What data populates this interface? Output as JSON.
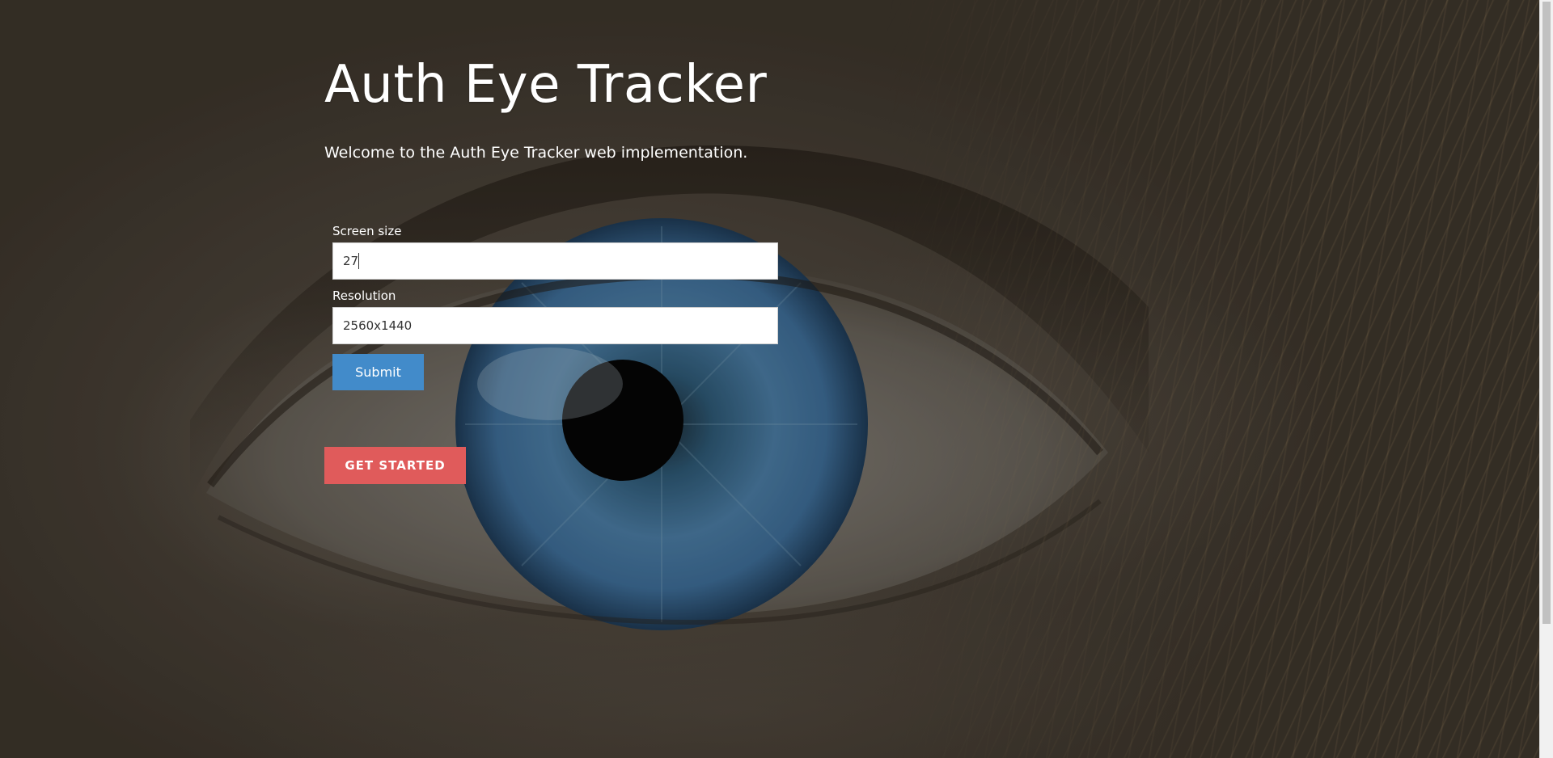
{
  "header": {
    "title": "Auth Eye Tracker",
    "subtitle": "Welcome to the Auth Eye Tracker web implementation."
  },
  "form": {
    "screen_size": {
      "label": "Screen size",
      "value": "27"
    },
    "resolution": {
      "label": "Resolution",
      "value": "2560x1440"
    },
    "submit_label": "Submit"
  },
  "cta": {
    "label": "GET STARTED"
  },
  "colors": {
    "submit_button": "#428bca",
    "get_started_button": "#e05b5b",
    "text": "#ffffff"
  },
  "icons": {
    "background": "eye-photo"
  }
}
